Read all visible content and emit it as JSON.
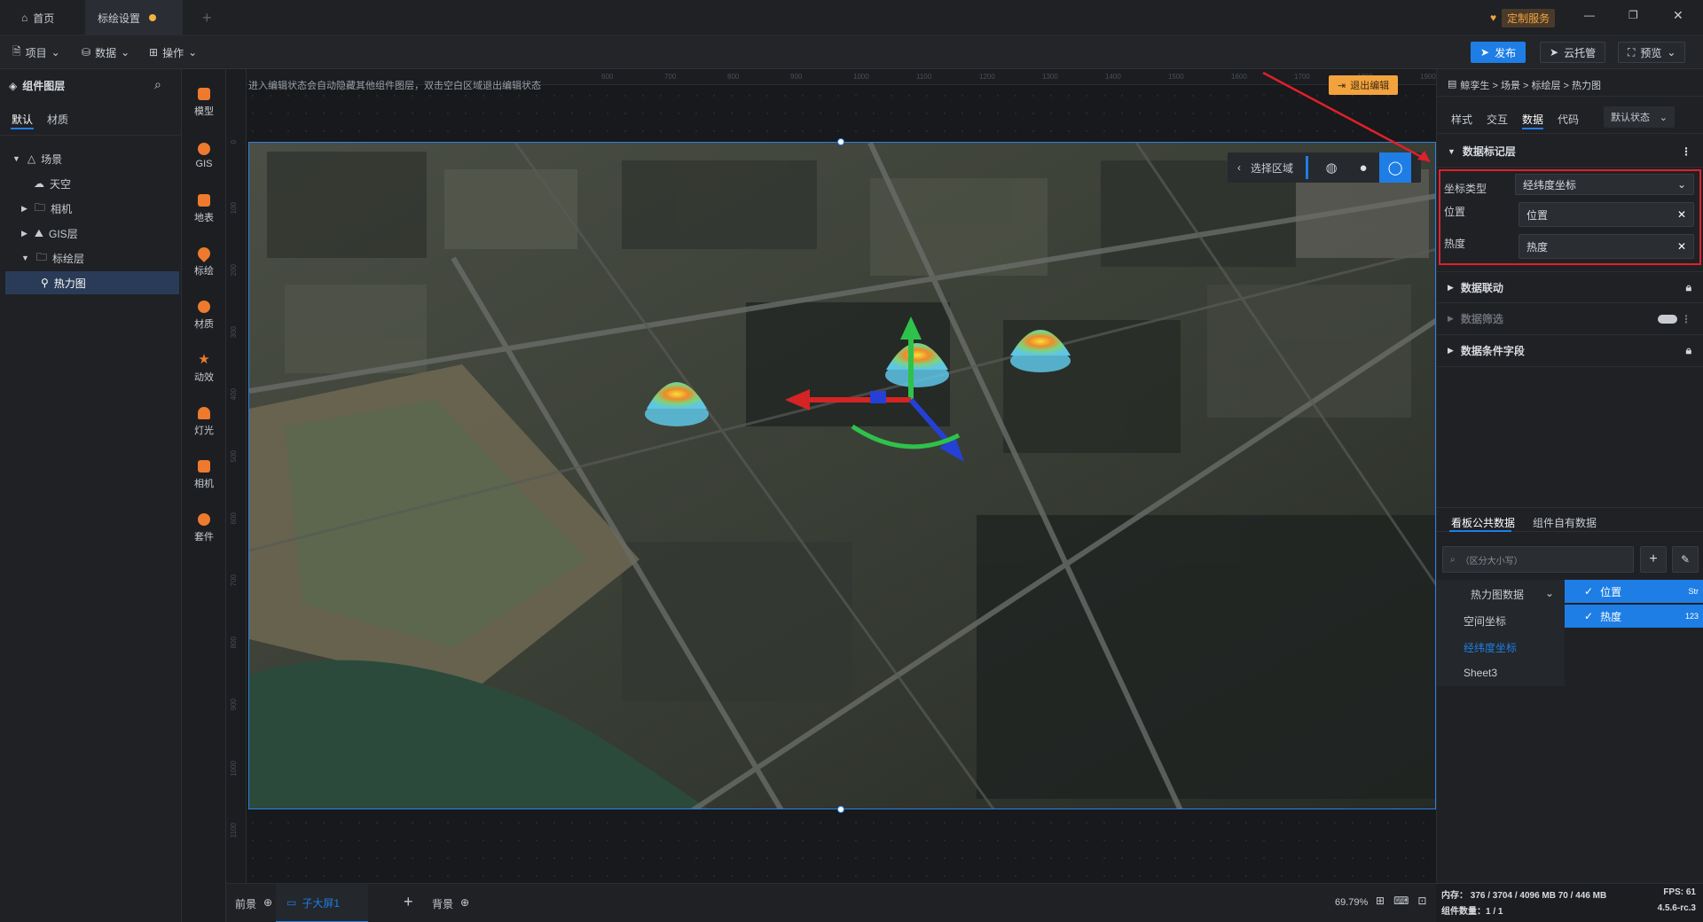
{
  "titlebar": {
    "tab_home": "首页",
    "tab_active": "标绘设置",
    "service_label": "定制服务"
  },
  "toolbar": {
    "project": "项目",
    "data": "数据",
    "operate": "操作",
    "publish": "发布",
    "cloud": "云托管",
    "preview": "预览"
  },
  "left": {
    "title": "组件图层",
    "tabs": [
      "默认",
      "材质"
    ],
    "tree": [
      "场景",
      "天空",
      "相机",
      "GIS层",
      "标绘层",
      "热力图"
    ]
  },
  "tools": [
    "模型",
    "GIS",
    "地表",
    "标绘",
    "材质",
    "动效",
    "灯光",
    "相机",
    "套件"
  ],
  "canvas": {
    "hint": "进入编辑状态会自动隐藏其他组件图层，双击空白区域退出编辑状态",
    "exit_edit": "退出编辑",
    "select_region": "选择区域",
    "ruler_top": [
      "600",
      "700",
      "800",
      "900",
      "1000",
      "1100",
      "1200",
      "1300",
      "1400",
      "1500",
      "1600",
      "1700",
      "1800",
      "1900"
    ],
    "ruler_left": [
      "0",
      "100",
      "200",
      "300",
      "400",
      "500",
      "600",
      "700",
      "800",
      "900",
      "1000",
      "1100"
    ]
  },
  "right": {
    "breadcrumb": "鲸孪生 > 场景 > 标绘层 > 热力图",
    "tabs": [
      "样式",
      "交互",
      "数据",
      "代码"
    ],
    "state_select": "默认状态",
    "section_data_layer": "数据标记层",
    "coord_type_label": "坐标类型",
    "coord_type_value": "经纬度坐标",
    "position_label": "位置",
    "position_value": "位置",
    "heat_label": "热度",
    "heat_value": "热度",
    "section_link": "数据联动",
    "section_filter": "数据筛选",
    "section_cond": "数据条件字段",
    "data_tabs": [
      "看板公共数据",
      "组件自有数据"
    ],
    "search_placeholder": "（区分大小写）",
    "sources": [
      "热力图数据",
      "空间坐标",
      "经纬度坐标",
      "Sheet3"
    ],
    "fields": [
      {
        "name": "位置",
        "type": "Str"
      },
      {
        "name": "热度",
        "type": "123"
      }
    ]
  },
  "bottom": {
    "front": "前景",
    "screen": "子大屏1",
    "background": "背景",
    "zoom": "69.79%"
  },
  "status": {
    "memory": "内存： 376 / 3704 / 4096 MB  70 / 446 MB",
    "fps": "FPS:  61",
    "components": "组件数量：1 / 1",
    "version": "4.5.6-rc.3"
  },
  "colors": {
    "accent": "#1e7ee6",
    "highlight_box": "#e0202a",
    "warning": "#f3a33d"
  }
}
